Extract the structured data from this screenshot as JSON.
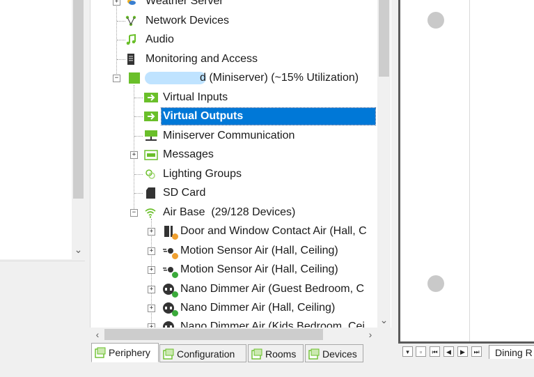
{
  "tree": {
    "items": [
      {
        "label": "Weather Server",
        "icon": "weather-icon",
        "expander": "+"
      },
      {
        "label": "Network Devices",
        "icon": "network-icon"
      },
      {
        "label": "Audio",
        "icon": "music-note-icon"
      },
      {
        "label": "Monitoring and Access",
        "icon": "device-icon"
      },
      {
        "label": "d (Miniserver) (~15% Utilization)",
        "icon": "miniserver-icon",
        "expander": "−"
      },
      {
        "label": "Virtual Inputs",
        "icon": "virtual-input-icon"
      },
      {
        "label": "Virtual Outputs",
        "icon": "virtual-output-icon",
        "selected": true
      },
      {
        "label": "Miniserver Communication",
        "icon": "communication-icon"
      },
      {
        "label": "Messages",
        "icon": "messages-icon",
        "expander": "+"
      },
      {
        "label": "Lighting Groups",
        "icon": "lighting-icon"
      },
      {
        "label": "SD Card",
        "icon": "sd-card-icon"
      },
      {
        "label": "Air Base  (29/128 Devices)",
        "icon": "wifi-icon",
        "expander": "−"
      },
      {
        "label": "Door and Window Contact Air (Hall, C",
        "icon": "door-contact-icon",
        "expander": "+",
        "status": "#f0a030"
      },
      {
        "label": "Motion Sensor Air (Hall, Ceiling)",
        "icon": "motion-sensor-icon",
        "expander": "+",
        "status": "#f0a030"
      },
      {
        "label": "Motion Sensor Air (Hall, Ceiling)",
        "icon": "motion-sensor-icon",
        "expander": "+",
        "status": "#3aaa3a"
      },
      {
        "label": "Nano Dimmer Air (Guest Bedroom, C",
        "icon": "dimmer-icon",
        "expander": "+",
        "status": "#3aaa3a"
      },
      {
        "label": "Nano Dimmer Air (Hall, Ceiling)",
        "icon": "dimmer-icon",
        "expander": "+",
        "status": "#3aaa3a"
      },
      {
        "label": "Nano Dimmer Air (Kids Bedroom, Cei",
        "icon": "dimmer-icon",
        "expander": "+",
        "status": "#3aaa3a"
      }
    ]
  },
  "tabs": [
    {
      "label": "Periphery",
      "active": true
    },
    {
      "label": "Configuration"
    },
    {
      "label": "Rooms"
    },
    {
      "label": "Devices"
    }
  ],
  "right": {
    "sheet_tab_label": "Dining R",
    "nav_buttons": [
      "first",
      "prev-page",
      "first-sheet",
      "prev",
      "next",
      "last"
    ]
  },
  "colors": {
    "selection": "#0078d7",
    "accent_green": "#6abf2a",
    "status_orange": "#f0a030",
    "status_green": "#3aaa3a"
  }
}
